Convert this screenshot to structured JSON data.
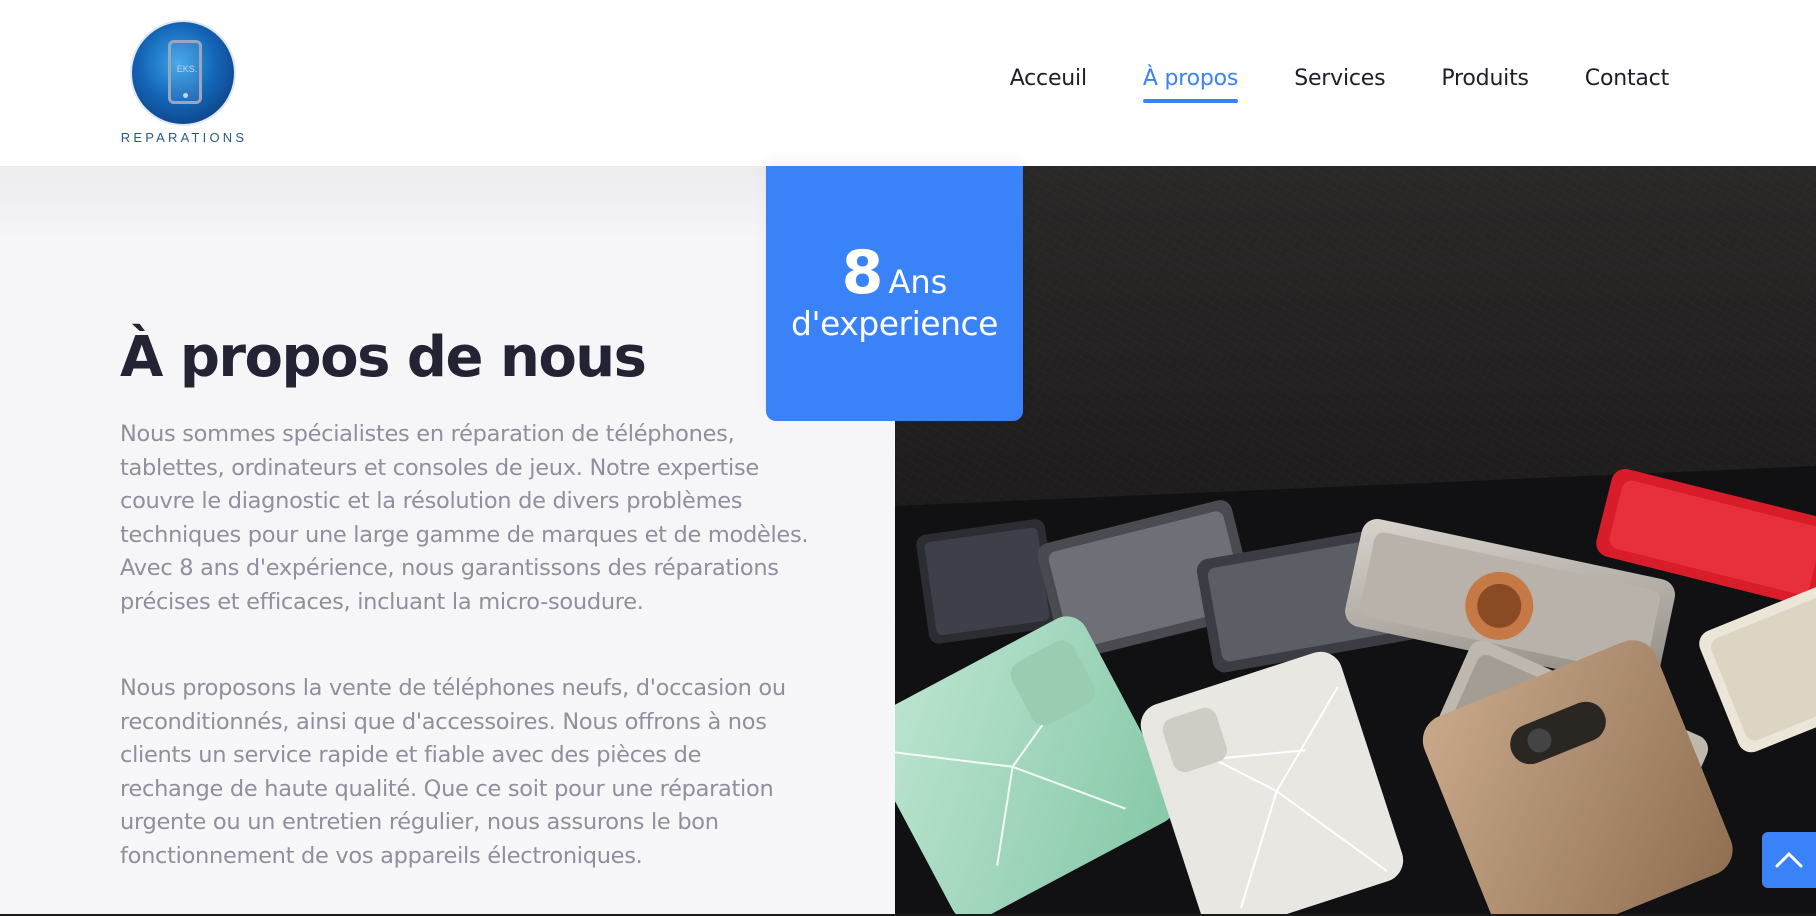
{
  "brand": {
    "logo_phone_text": "EKS.",
    "logo_text": "REPARATIONS"
  },
  "nav": {
    "items": [
      {
        "label": "Acceuil",
        "active": false
      },
      {
        "label": "À propos",
        "active": true
      },
      {
        "label": "Services",
        "active": false
      },
      {
        "label": "Produits",
        "active": false
      },
      {
        "label": "Contact",
        "active": false
      }
    ]
  },
  "badge": {
    "number": "8",
    "unit": "Ans",
    "caption": "d'experience"
  },
  "about": {
    "title": "À propos de nous",
    "paragraph_1": "Nous sommes spécialistes en réparation de téléphones, tablettes, ordinateurs et consoles de jeux. Notre expertise couvre le diagnostic et la résolution de divers problèmes techniques pour une large gamme de marques et de modèles. Avec 8 ans d'expérience, nous garantissons des réparations précises et efficaces, incluant la micro-soudure.",
    "paragraph_2": "Nous proposons la vente de téléphones neufs, d'occasion ou reconditionnés, ainsi que d'accessoires. Nous offrons à nos clients un service rapide et fiable avec des pièces de rechange de haute qualité. Que ce soit pour une réparation urgente ou un entretien régulier, nous assurons le bon fonctionnement de vos appareils électroniques."
  },
  "colors": {
    "accent": "#3a82f7",
    "title": "#232333",
    "body_text": "#8f8f9e",
    "nav_text": "#1e1e28"
  },
  "icons": {
    "scroll_top": "chevron-up-icon"
  }
}
